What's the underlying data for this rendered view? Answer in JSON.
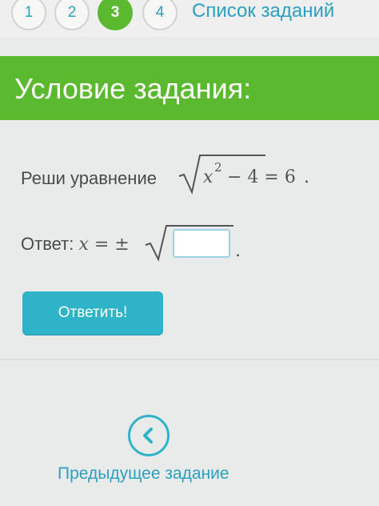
{
  "nav": {
    "steps": [
      "1",
      "2",
      "3",
      "4"
    ],
    "active_step": "3",
    "task_list_label": "Список заданий"
  },
  "header": {
    "title": "Условие задания:"
  },
  "task": {
    "prompt_label": "Реши уравнение",
    "equation_var": "x",
    "equation_exp": "2",
    "equation_rest": "− 4 = 6",
    "equation_end": "."
  },
  "answer": {
    "label": "Ответ:",
    "lhs": "x = ±",
    "end": "."
  },
  "actions": {
    "submit_label": "Ответить!",
    "prev_label": "Предыдущее задание"
  },
  "colors": {
    "accent_green": "#5ab92e",
    "accent_cyan": "#2fb3c8",
    "link_blue": "#2c9fc3"
  },
  "icons": {
    "prev": "chevron-left-icon"
  }
}
